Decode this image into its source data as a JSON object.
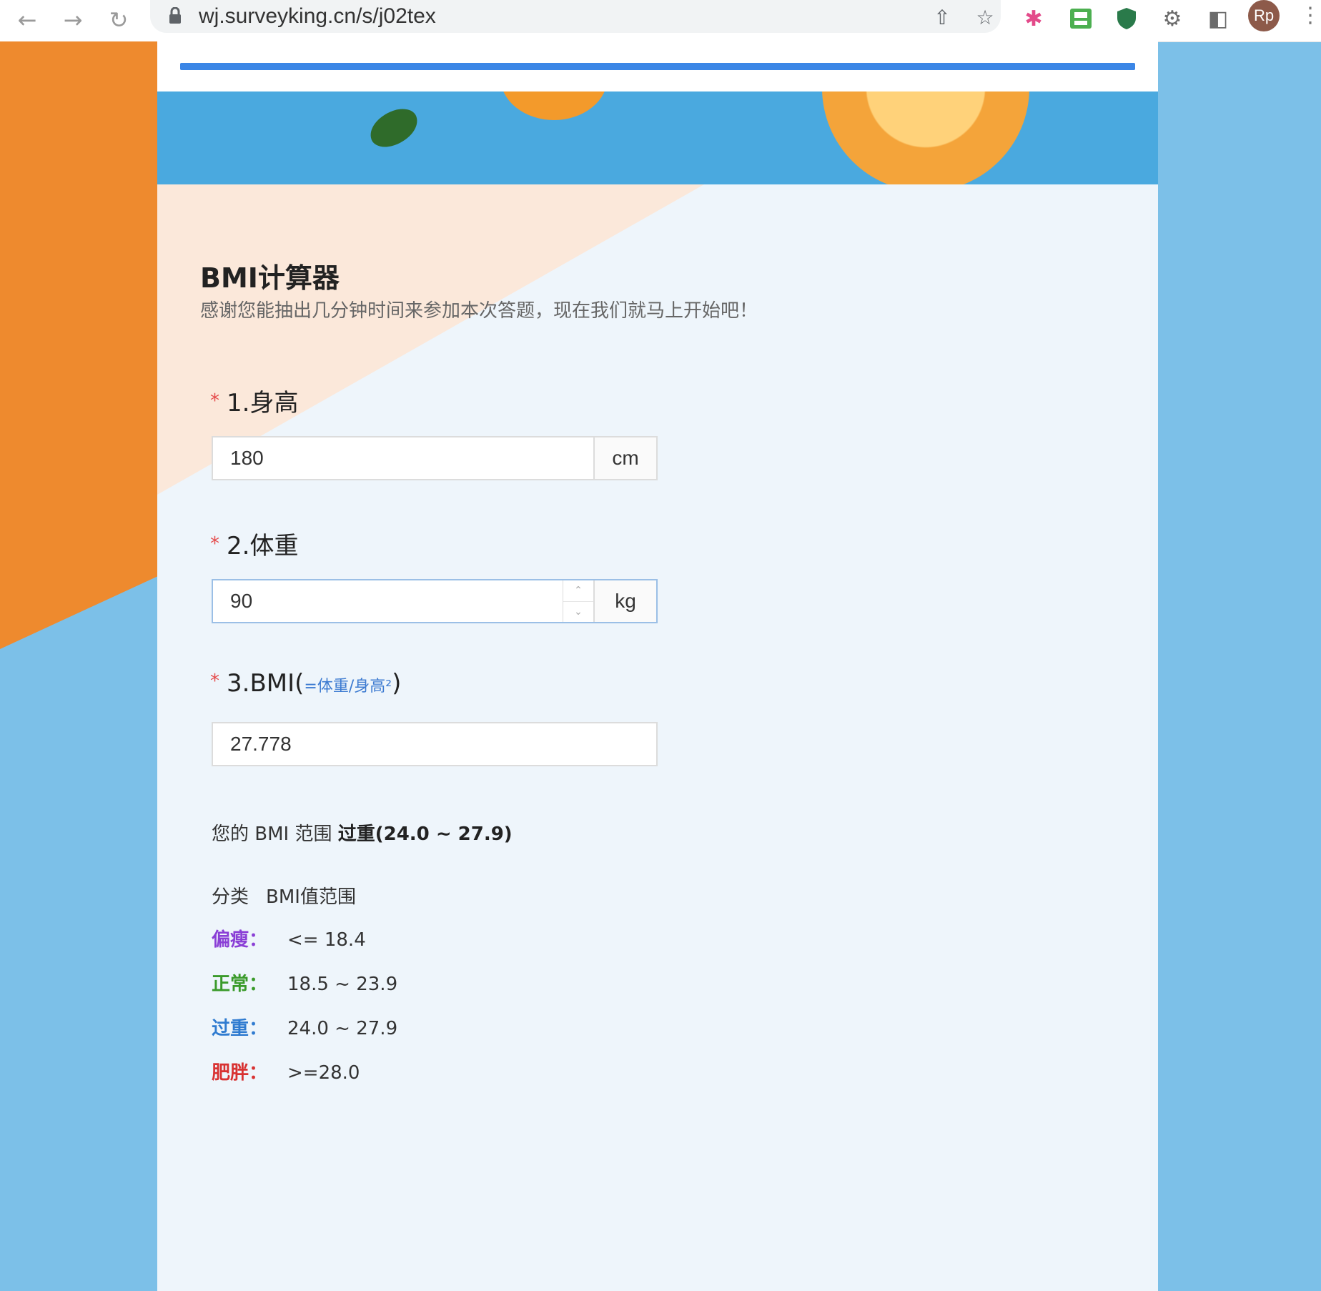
{
  "browser": {
    "url": "wj.surveyking.cn/s/j02tex",
    "avatar_initials": "Rp"
  },
  "survey": {
    "progress_percent": 100,
    "title": "BMI计算器",
    "subtitle": "感谢您能抽出几分钟时间来参加本次答题，现在我们就马上开始吧！",
    "questions": [
      {
        "label": "1.身高",
        "value": "180",
        "unit": "cm"
      },
      {
        "label": "2.体重",
        "value": "90",
        "unit": "kg"
      },
      {
        "label": "3.BMI(",
        "hint": "=体重/身高²",
        "label_end": ")",
        "value": "27.778"
      }
    ],
    "result_prefix": "您的 BMI 范围",
    "result_value": "过重(24.0 ~ 27.9)",
    "table_header": [
      "分类",
      "BMI值范围"
    ],
    "ranges": [
      {
        "category": "偏瘦：",
        "range": "<= 18.4",
        "color": "#8a3fd6"
      },
      {
        "category": "正常：",
        "range": "18.5 ~ 23.9",
        "color": "#3a9a2a"
      },
      {
        "category": "过重：",
        "range": "24.0 ~ 27.9",
        "color": "#2f7bd0"
      },
      {
        "category": "肥胖：",
        "range": ">=28.0",
        "color": "#d83232"
      }
    ]
  },
  "colors": {
    "accent": "#3b86e6",
    "required_star": "#e54b4b",
    "background_blue": "#7cc0e8",
    "background_orange": "#ee8a2e"
  }
}
